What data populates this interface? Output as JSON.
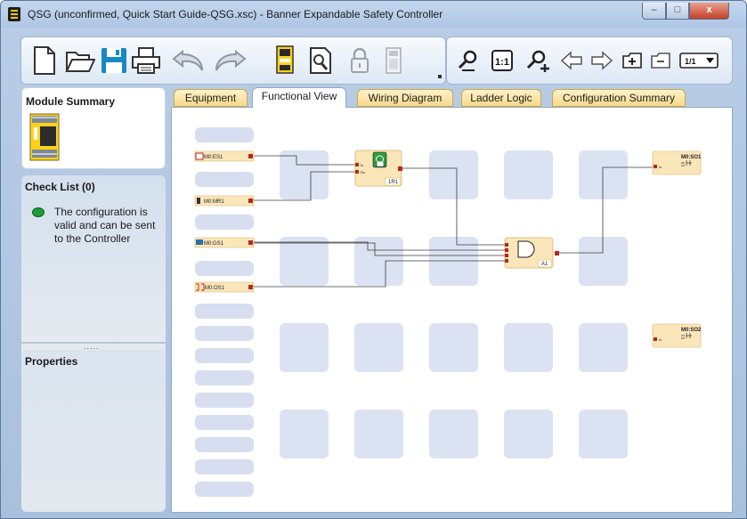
{
  "window": {
    "title": "QSG (unconfirmed, Quick Start Guide-QSG.xsc) - Banner Expandable Safety Controller",
    "close_label": "x",
    "min_label": "–",
    "max_label": "□"
  },
  "toolbar": {
    "left": [
      {
        "name": "new-document-icon"
      },
      {
        "name": "open-folder-icon"
      },
      {
        "name": "save-icon"
      },
      {
        "name": "print-icon"
      },
      {
        "name": "undo-icon"
      },
      {
        "name": "redo-icon"
      },
      {
        "name": "controller-device-icon"
      },
      {
        "name": "document-search-icon"
      },
      {
        "name": "lock-icon"
      },
      {
        "name": "module-disabled-icon"
      }
    ],
    "right": [
      {
        "name": "zoom-out-icon"
      },
      {
        "name": "zoom-actual-icon",
        "label": "1:1"
      },
      {
        "name": "zoom-in-icon"
      },
      {
        "name": "arrow-left-icon"
      },
      {
        "name": "arrow-right-icon"
      },
      {
        "name": "add-page-icon"
      },
      {
        "name": "remove-page-icon"
      },
      {
        "name": "page-select-icon",
        "label": "1/1"
      }
    ]
  },
  "left_panel": {
    "module_summary_title": "Module Summary",
    "checklist_title": "Check List (0)",
    "checklist_message": "The configuration is valid and can be sent to the Controller",
    "checklist_status_color": "#1f9d35",
    "properties_title": "Properties",
    "splitter_grip": "....."
  },
  "tabs": [
    {
      "label": "Equipment",
      "active": false
    },
    {
      "label": "Functional View",
      "active": true
    },
    {
      "label": "Wiring Diagram",
      "active": false
    },
    {
      "label": "Ladder Logic",
      "active": false
    },
    {
      "label": "Configuration Summary",
      "active": false
    }
  ],
  "diagram": {
    "inputs": [
      {
        "label": "M0:ES1",
        "icon": "estop-icon"
      },
      {
        "label": "M0:MR1",
        "icon": "manual-reset-icon"
      },
      {
        "label": "M0:GS1",
        "icon": "gate-switch-icon"
      },
      {
        "label": "M0:OS1",
        "icon": "optical-sensor-icon"
      }
    ],
    "reset_block": {
      "label": "1R1",
      "pin_in": "In",
      "pin_rs": "Rs"
    },
    "and_block": {
      "label": "A1"
    },
    "outputs": [
      {
        "label": "M0:SO1",
        "pin": "In"
      },
      {
        "label": "M0:SO2",
        "pin": "In"
      }
    ],
    "colors": {
      "node_fill": "#fbe6ba",
      "node_stroke": "#d6b365",
      "pin": "#b4281d",
      "grid_cell": "#dbe2f1",
      "wire": "#3c3c3c"
    }
  }
}
